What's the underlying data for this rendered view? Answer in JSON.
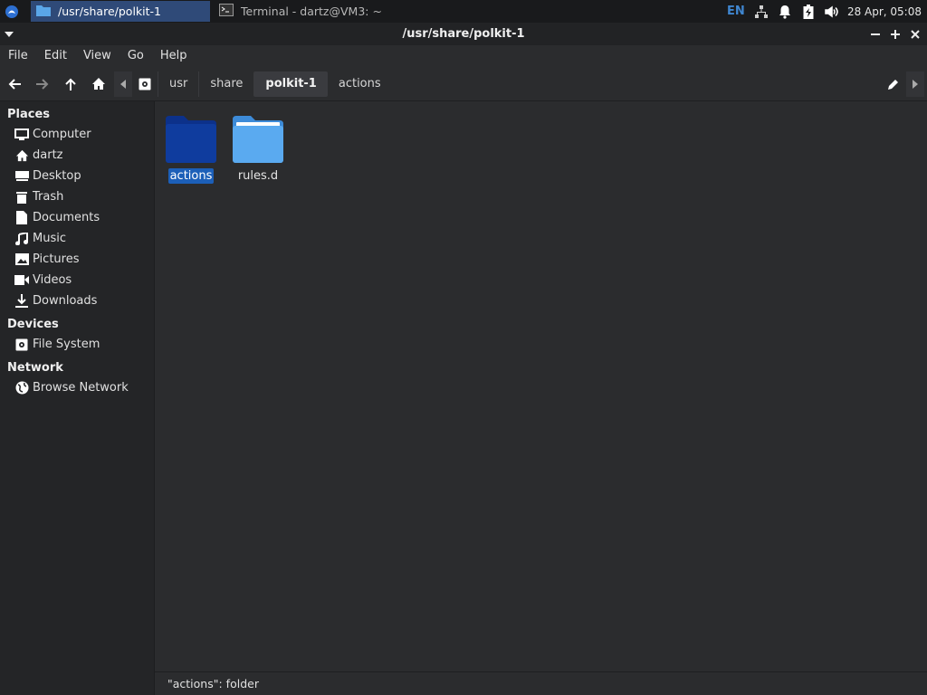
{
  "panel": {
    "tasks": [
      {
        "label": "/usr/share/polkit-1",
        "icon": "folder-icon"
      },
      {
        "label": "Terminal - dartz@VM3: ~",
        "icon": "terminal-icon"
      }
    ],
    "language": "EN",
    "clock": "28 Apr, 05:08"
  },
  "window": {
    "title": "/usr/share/polkit-1"
  },
  "menubar": {
    "items": [
      "File",
      "Edit",
      "View",
      "Go",
      "Help"
    ]
  },
  "pathbar": {
    "crumbs": [
      "usr",
      "share",
      "polkit-1",
      "actions"
    ],
    "current_index": 2
  },
  "sidebar": {
    "places_title": "Places",
    "places": [
      "Computer",
      "dartz",
      "Desktop",
      "Trash",
      "Documents",
      "Music",
      "Pictures",
      "Videos",
      "Downloads"
    ],
    "devices_title": "Devices",
    "devices": [
      "File System"
    ],
    "network_title": "Network",
    "network": [
      "Browse Network"
    ]
  },
  "files": [
    {
      "name": "actions",
      "selected": true
    },
    {
      "name": "rules.d",
      "selected": false
    }
  ],
  "status": {
    "text": "\"actions\": folder"
  },
  "colors": {
    "accent": "#1c5fb8",
    "folder_selected": "#0f3c9e",
    "folder": "#4a9fe6"
  }
}
